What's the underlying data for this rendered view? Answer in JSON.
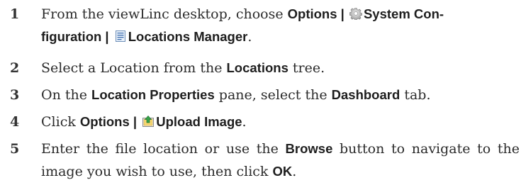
{
  "steps": [
    {
      "number": "1",
      "t1": "From the viewLinc desktop, choose ",
      "b1": "Options | ",
      "icon1": "gear-icon",
      "b2": "System Con-",
      "b3": "figuration | ",
      "icon2": "list-document-icon",
      "b4": "Locations Manager",
      "t2": "."
    },
    {
      "number": "2",
      "t1": "Select a Location from the ",
      "b1": "Locations",
      "t2": " tree."
    },
    {
      "number": "3",
      "t1": "On the ",
      "b1": "Location Properties",
      "t2": " pane, select the ",
      "b2": "Dashboard",
      "t3": " tab."
    },
    {
      "number": "4",
      "t1": "Click ",
      "b1": "Options | ",
      "icon1": "upload-image-icon",
      "b2": "Upload Image",
      "t2": "."
    },
    {
      "number": "5",
      "t1": "Enter the file location or use the ",
      "b1": "Browse",
      "t2": " button to navigate to the image you wish to use, then click ",
      "b2": "OK",
      "t3": "."
    }
  ]
}
